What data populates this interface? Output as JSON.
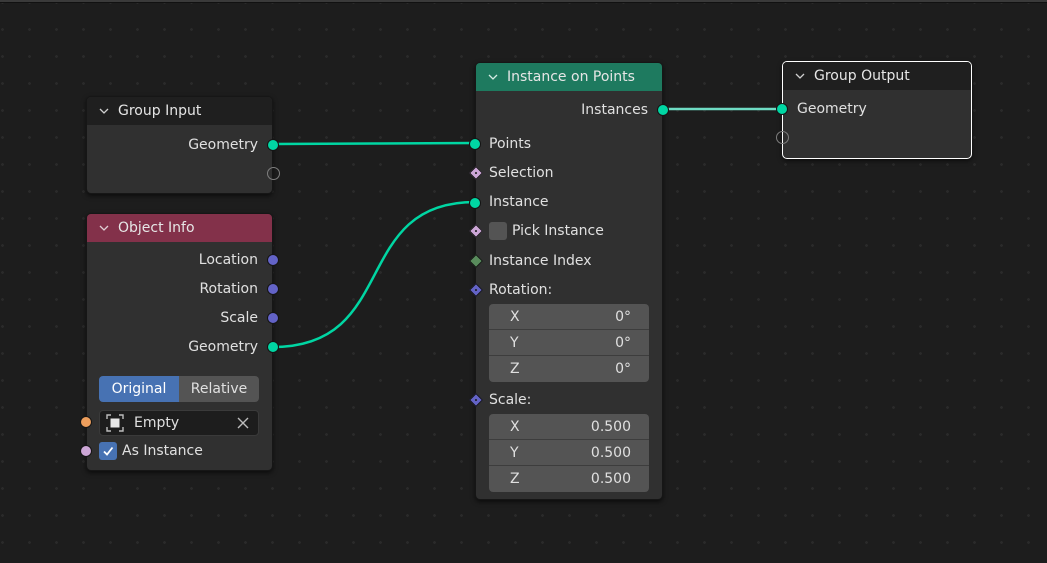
{
  "editor": "Geometry Node Editor",
  "colors": {
    "geometry_socket": "#00d6a3",
    "vector_socket": "#6363c7",
    "object_socket": "#ed9e5c",
    "boolean_socket": "#cca6d6",
    "integer_socket": "#598c5c",
    "input_header": "#83314a",
    "geometry_header": "#1e7a5f",
    "accent": "#4772b3"
  },
  "nodes": {
    "group_input": {
      "title": "Group Input",
      "outputs": [
        "Geometry"
      ]
    },
    "object_info": {
      "title": "Object Info",
      "outputs": [
        "Location",
        "Rotation",
        "Scale",
        "Geometry"
      ],
      "transform_space": {
        "options": [
          "Original",
          "Relative"
        ],
        "selected": "Original"
      },
      "object": {
        "value": "Empty"
      },
      "as_instance": {
        "label": "As Instance",
        "checked": true
      }
    },
    "instance_on_points": {
      "title": "Instance on Points",
      "outputs": [
        "Instances"
      ],
      "inputs": {
        "points": "Points",
        "selection": "Selection",
        "instance": "Instance",
        "pick_instance": {
          "label": "Pick Instance",
          "checked": false
        },
        "instance_index": "Instance Index",
        "rotation": {
          "label": "Rotation:",
          "x": {
            "axis": "X",
            "value": "0°"
          },
          "y": {
            "axis": "Y",
            "value": "0°"
          },
          "z": {
            "axis": "Z",
            "value": "0°"
          }
        },
        "scale": {
          "label": "Scale:",
          "x": {
            "axis": "X",
            "value": "0.500"
          },
          "y": {
            "axis": "Y",
            "value": "0.500"
          },
          "z": {
            "axis": "Z",
            "value": "0.500"
          }
        }
      }
    },
    "group_output": {
      "title": "Group Output",
      "inputs": [
        "Geometry"
      ]
    }
  },
  "links": [
    {
      "from": "Group Input.Geometry",
      "to": "Instance on Points.Points"
    },
    {
      "from": "Object Info.Geometry",
      "to": "Instance on Points.Instance"
    },
    {
      "from": "Instance on Points.Instances",
      "to": "Group Output.Geometry"
    }
  ]
}
